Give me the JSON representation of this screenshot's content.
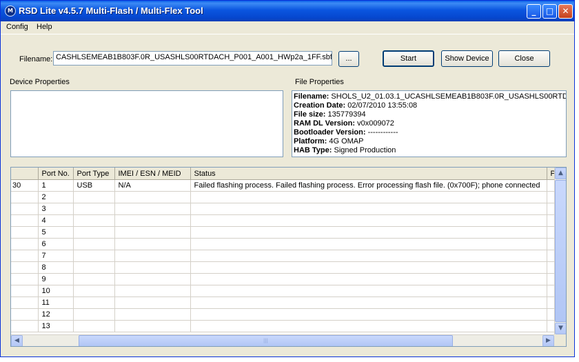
{
  "window": {
    "title": "RSD Lite v4.5.7 Multi-Flash / Multi-Flex Tool",
    "app_icon_glyph": "M",
    "controls": {
      "minimize": "_",
      "maximize": "□",
      "close": "✕"
    }
  },
  "menu": {
    "items": [
      "Config",
      "Help"
    ]
  },
  "file_select": {
    "label": "Filename:",
    "value": "CASHLSEMEAB1B803F.0R_USASHLS00RTDACH_P001_A001_HWp2a_1FF.sbf",
    "browse_label": "..."
  },
  "buttons": {
    "start": "Start",
    "show_device": "Show Device",
    "close": "Close"
  },
  "device_properties": {
    "label": "Device Properties"
  },
  "file_properties": {
    "label": "File Properties",
    "rows": [
      {
        "key": "Filename:",
        "value": "SHOLS_U2_01.03.1_UCASHLSEMEAB1B803F.0R_USASHLS00RTD"
      },
      {
        "key": "Creation Date:",
        "value": "02/07/2010 13:55:08"
      },
      {
        "key": "File size:",
        "value": "135779394"
      },
      {
        "key": "RAM DL Version:",
        "value": "v0x009072"
      },
      {
        "key": "Bootloader Version:",
        "value": "------------"
      },
      {
        "key": "Platform:",
        "value": "4G OMAP"
      },
      {
        "key": "HAB Type:",
        "value": "Signed Production"
      }
    ]
  },
  "grid": {
    "columns": [
      "",
      "Port No.",
      "Port Type",
      "IMEI / ESN / MEID",
      "Status",
      "P"
    ],
    "rows": [
      {
        "c0": "30",
        "port": "1",
        "type": "USB",
        "imei": "N/A",
        "status": "Failed flashing process. Failed flashing process. Error processing flash file. (0x700F); phone connected"
      },
      {
        "c0": "",
        "port": "2",
        "type": "",
        "imei": "",
        "status": ""
      },
      {
        "c0": "",
        "port": "3",
        "type": "",
        "imei": "",
        "status": ""
      },
      {
        "c0": "",
        "port": "4",
        "type": "",
        "imei": "",
        "status": ""
      },
      {
        "c0": "",
        "port": "5",
        "type": "",
        "imei": "",
        "status": ""
      },
      {
        "c0": "",
        "port": "6",
        "type": "",
        "imei": "",
        "status": ""
      },
      {
        "c0": "",
        "port": "7",
        "type": "",
        "imei": "",
        "status": ""
      },
      {
        "c0": "",
        "port": "8",
        "type": "",
        "imei": "",
        "status": ""
      },
      {
        "c0": "",
        "port": "9",
        "type": "",
        "imei": "",
        "status": ""
      },
      {
        "c0": "",
        "port": "10",
        "type": "",
        "imei": "",
        "status": ""
      },
      {
        "c0": "",
        "port": "11",
        "type": "",
        "imei": "",
        "status": ""
      },
      {
        "c0": "",
        "port": "12",
        "type": "",
        "imei": "",
        "status": ""
      },
      {
        "c0": "",
        "port": "13",
        "type": "",
        "imei": "",
        "status": ""
      }
    ]
  },
  "scrollbars": {
    "up": "▲",
    "down": "▼",
    "left": "◀",
    "right": "▶",
    "grip": "|||"
  }
}
